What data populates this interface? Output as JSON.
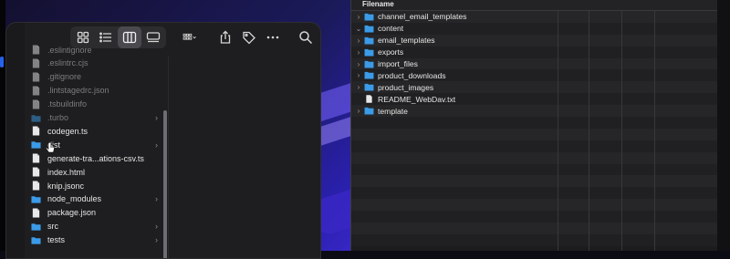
{
  "right_panel": {
    "header": "Filename",
    "rows": [
      {
        "label": "channel_email_templates",
        "type": "folder",
        "expanded": false
      },
      {
        "label": "content",
        "type": "folder",
        "expanded": true
      },
      {
        "label": "email_templates",
        "type": "folder",
        "expanded": false
      },
      {
        "label": "exports",
        "type": "folder",
        "expanded": false
      },
      {
        "label": "import_files",
        "type": "folder",
        "expanded": false
      },
      {
        "label": "product_downloads",
        "type": "folder",
        "expanded": false
      },
      {
        "label": "product_images",
        "type": "folder",
        "expanded": false
      },
      {
        "label": "README_WebDav.txt",
        "type": "file",
        "expanded": false
      },
      {
        "label": "template",
        "type": "folder",
        "expanded": false
      }
    ]
  },
  "finder": {
    "items": [
      {
        "label": ".eslintignore",
        "type": "file",
        "dim": true,
        "chevron": false
      },
      {
        "label": ".eslintrc.cjs",
        "type": "file",
        "dim": true,
        "chevron": false
      },
      {
        "label": ".gitignore",
        "type": "file",
        "dim": true,
        "chevron": false
      },
      {
        "label": ".lintstagedrc.json",
        "type": "file",
        "dim": true,
        "chevron": false
      },
      {
        "label": ".tsbuildinfo",
        "type": "file",
        "dim": true,
        "chevron": false
      },
      {
        "label": ".turbo",
        "type": "folder",
        "dim": true,
        "chevron": true
      },
      {
        "label": "codegen.ts",
        "type": "file",
        "dim": false,
        "chevron": false
      },
      {
        "label": "dist",
        "type": "folder",
        "dim": false,
        "chevron": true
      },
      {
        "label": "generate-tra...ations-csv.ts",
        "type": "file",
        "dim": false,
        "chevron": false
      },
      {
        "label": "index.html",
        "type": "file",
        "dim": false,
        "chevron": false
      },
      {
        "label": "knip.jsonc",
        "type": "file",
        "dim": false,
        "chevron": false
      },
      {
        "label": "node_modules",
        "type": "folder",
        "dim": false,
        "chevron": true
      },
      {
        "label": "package.json",
        "type": "file",
        "dim": false,
        "chevron": false
      },
      {
        "label": "src",
        "type": "folder",
        "dim": false,
        "chevron": true
      },
      {
        "label": "tests",
        "type": "folder",
        "dim": false,
        "chevron": true
      }
    ],
    "toolbar": {
      "icons": [
        "icon-view-grid",
        "list-view-icon",
        "column-view-icon",
        "gallery-view-icon",
        "group-by-icon",
        "share-icon",
        "tag-icon",
        "more-icon",
        "search-icon"
      ]
    }
  },
  "colors": {
    "folder": "#3b9be8",
    "file": "#e8e8ea",
    "accent": "#2563eb"
  }
}
